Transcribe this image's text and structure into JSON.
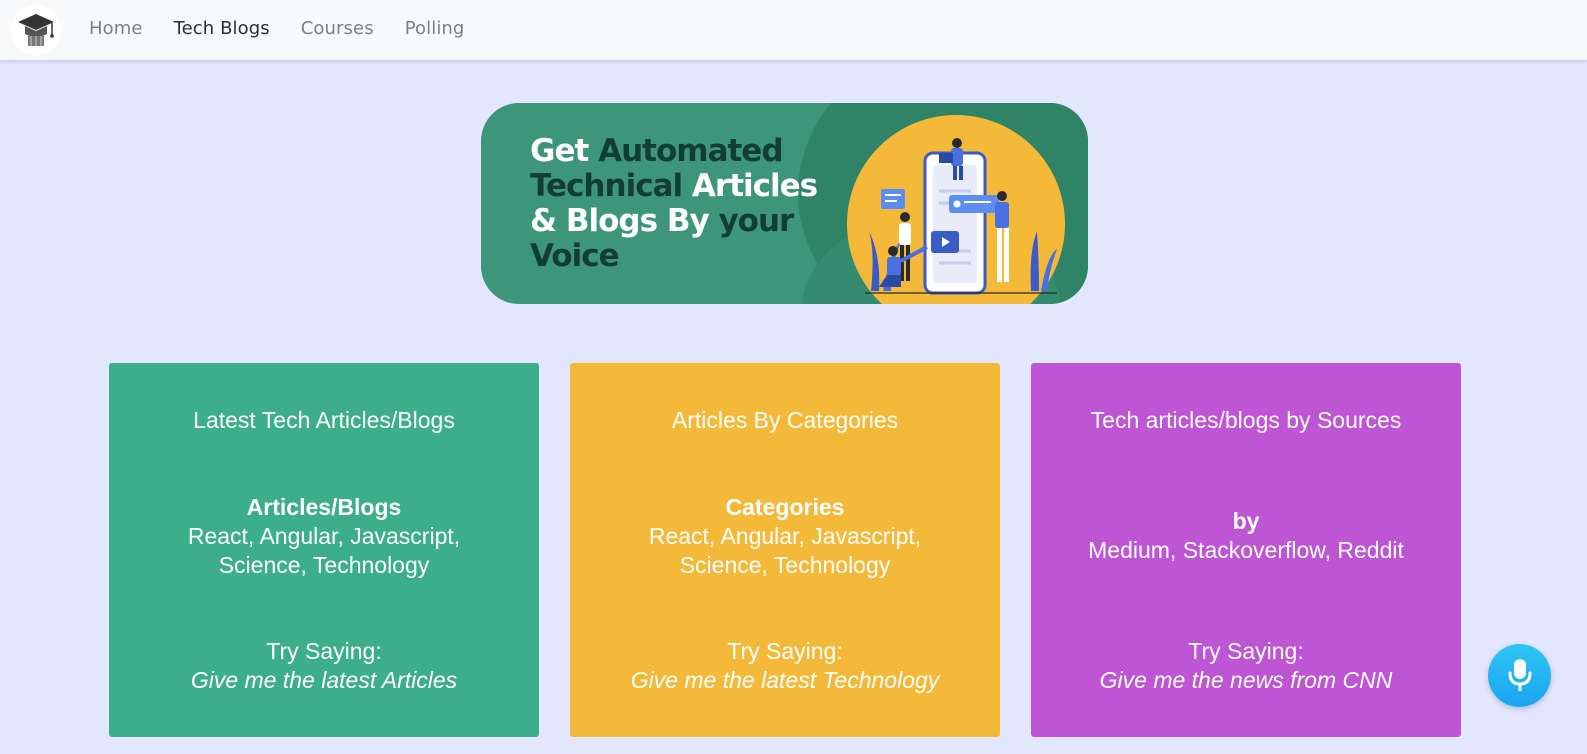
{
  "nav": {
    "logo_alt": "graduation-cap-logo",
    "links": [
      {
        "label": "Home",
        "active": false
      },
      {
        "label": "Tech Blogs",
        "active": true
      },
      {
        "label": "Courses",
        "active": false
      },
      {
        "label": "Polling",
        "active": false
      }
    ]
  },
  "banner": {
    "line1_a": "Get ",
    "line1_b": "Automated",
    "line2_a": "Technical ",
    "line2_b": "Articles",
    "line3_a": "& Blogs By ",
    "line3_b": "your",
    "line4": "Voice"
  },
  "cards": [
    {
      "title": "Latest Tech Articles/Blogs",
      "heading": "Articles/Blogs",
      "items": "React, Angular, Javascript, Science, Technology",
      "try_label": "Try Saying:",
      "example": "Give me the latest Articles",
      "color": "#3cae89"
    },
    {
      "title": "Articles By Categories",
      "heading": "Categories",
      "items": "React, Angular, Javascript, Science, Technology",
      "try_label": "Try Saying:",
      "example": "Give me the latest Technology",
      "color": "#f5b93a"
    },
    {
      "title": "Tech articles/blogs by Sources",
      "heading": "by",
      "items": "Medium, Stackoverflow, Reddit",
      "try_label": "Try Saying:",
      "example": "Give me the news from CNN",
      "color": "#bd55d4"
    }
  ],
  "mic": {
    "icon": "microphone-icon"
  },
  "colors": {
    "background": "#e3e7fe",
    "banner": "#3e967a",
    "mic": "#1aa6ef"
  }
}
